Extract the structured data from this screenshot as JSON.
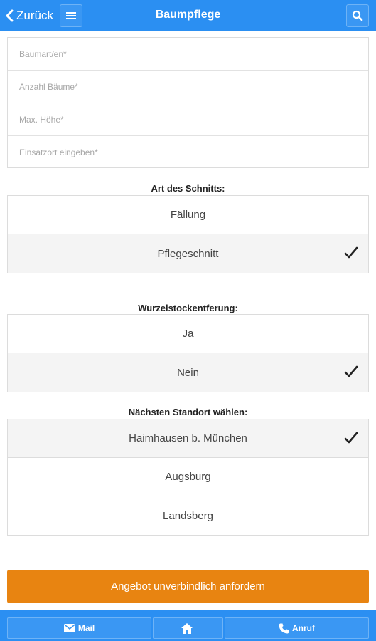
{
  "header": {
    "back_label": "Zurück",
    "title": "Baumpflege",
    "color": "#2b8ff2"
  },
  "form": {
    "fields": [
      {
        "placeholder": "Baumart/en*",
        "value": ""
      },
      {
        "placeholder": "Anzahl Bäume*",
        "value": ""
      },
      {
        "placeholder": "Max. Höhe*",
        "value": ""
      },
      {
        "placeholder": "Einsatzort eingeben*",
        "value": ""
      }
    ]
  },
  "schnitt": {
    "label": "Art des Schnitts:",
    "options": [
      {
        "label": "Fällung",
        "selected": false
      },
      {
        "label": "Pflegeschnitt",
        "selected": true
      }
    ]
  },
  "wurzel": {
    "label": "Wurzelstockentferung:",
    "options": [
      {
        "label": "Ja",
        "selected": false
      },
      {
        "label": "Nein",
        "selected": true
      }
    ]
  },
  "standort": {
    "label": "Nächsten Standort wählen:",
    "options": [
      {
        "label": "Haimhausen b. München",
        "selected": true
      },
      {
        "label": "Augsburg",
        "selected": false
      },
      {
        "label": "Landsberg",
        "selected": false
      }
    ]
  },
  "cta": {
    "label": "Angebot unverbindlich anfordern",
    "color": "#e88411"
  },
  "footer": {
    "mail_label": "Mail",
    "call_label": "Anruf",
    "icons": [
      "mail-icon",
      "home-icon",
      "phone-icon"
    ]
  }
}
